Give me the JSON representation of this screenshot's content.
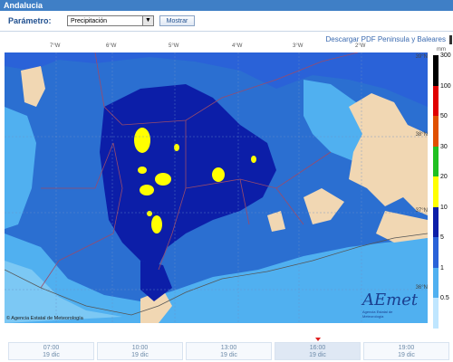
{
  "header": {
    "title": "Andalucia"
  },
  "controls": {
    "param_label": "Parámetro:",
    "select_value": "Precipitación",
    "button_label": "Mostrar"
  },
  "download": {
    "link_text": "Descargar PDF Peninsula y Baleares"
  },
  "map": {
    "lon_ticks": [
      "7°W",
      "6°W",
      "5°W",
      "4°W",
      "3°W",
      "2°W"
    ],
    "lat_ticks": [
      "39°N",
      "38°N",
      "37°N",
      "36°N"
    ],
    "credit": "© Agencia Estatal de Meteorología",
    "logo_text": "AEmet",
    "logo_sub": "Agencia Estatal de Meteorología"
  },
  "legend": {
    "unit": "mm",
    "items": [
      {
        "label": "300",
        "color": "#000000"
      },
      {
        "label": "100",
        "color": "#e00000"
      },
      {
        "label": "50",
        "color": "#e05000"
      },
      {
        "label": "30",
        "color": "#20c020"
      },
      {
        "label": "20",
        "color": "#ffff00"
      },
      {
        "label": "10",
        "color": "#0c1ea8"
      },
      {
        "label": "5",
        "color": "#2a62d8"
      },
      {
        "label": "1",
        "color": "#50b0f0"
      },
      {
        "label": "0.5",
        "color": "#bfe6ff"
      }
    ]
  },
  "timeline": [
    {
      "time": "07:00",
      "date": "19 dic"
    },
    {
      "time": "10:00",
      "date": "19 dic"
    },
    {
      "time": "13:00",
      "date": "19 dic"
    },
    {
      "time": "16:00",
      "date": "19 dic"
    },
    {
      "time": "19:00",
      "date": "19 dic"
    }
  ]
}
